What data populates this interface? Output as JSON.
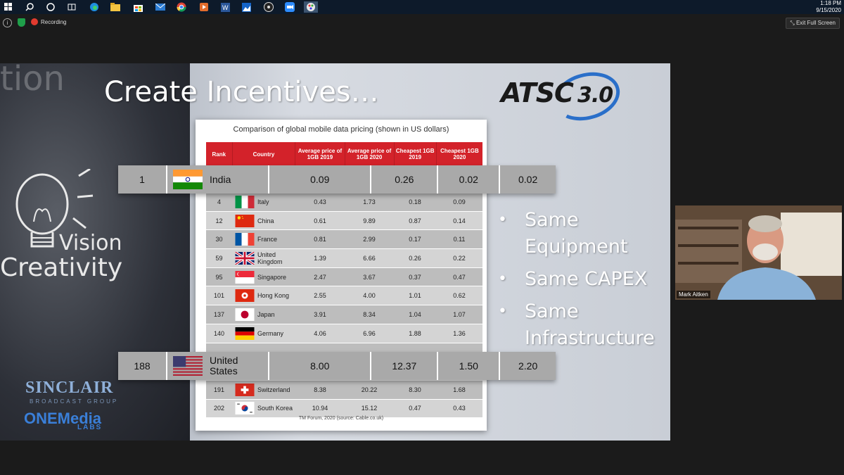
{
  "taskbar": {
    "icons": [
      "windows-icon",
      "search-icon",
      "task-view-icon",
      "widgets-icon",
      "edge-icon",
      "explorer-icon",
      "store-icon",
      "mail-icon",
      "chrome-icon",
      "media-icon",
      "word-icon",
      "photos-icon",
      "obs-icon",
      "zoom-icon",
      "paint-icon"
    ],
    "time": "1:18 PM",
    "date": "9/15/2020"
  },
  "zoom": {
    "recording_label": "Recording",
    "exit_label": "Exit Full Screen",
    "participant_name": "Mark Aitken"
  },
  "slide": {
    "title": "Create Incentives…",
    "logo_text": "ATSC",
    "logo_version": "3.0",
    "watermark_text": "tion",
    "vision": "Vision",
    "creativity": "Creativity",
    "sinclair": "SINCLAIR",
    "broadcast_group": "BROADCAST GROUP",
    "onemedia": "ONEMedia",
    "labs": "LABS",
    "bullets": [
      "Same Equipment",
      "Same CAPEX",
      "Same Infrastructure"
    ]
  },
  "table": {
    "title": "Comparison of global mobile data pricing (shown in US dollars)",
    "headers": [
      "Rank",
      "Country",
      "Average price of 1GB 2019",
      "Average price of 1GB 2020",
      "Cheapest 1GB 2019",
      "Cheapest 1GB 2020"
    ],
    "rows": [
      {
        "rank": "4",
        "country": "Italy",
        "flag": "italy",
        "a": "0.43",
        "b": "1.73",
        "c": "0.18",
        "d": "0.09"
      },
      {
        "rank": "12",
        "country": "China",
        "flag": "china",
        "a": "0.61",
        "b": "9.89",
        "c": "0.87",
        "d": "0.14"
      },
      {
        "rank": "30",
        "country": "France",
        "flag": "france",
        "a": "0.81",
        "b": "2.99",
        "c": "0.17",
        "d": "0.11"
      },
      {
        "rank": "59",
        "country": "United Kingdom",
        "flag": "uk",
        "a": "1.39",
        "b": "6.66",
        "c": "0.26",
        "d": "0.22"
      },
      {
        "rank": "95",
        "country": "Singapore",
        "flag": "singapore",
        "a": "2.47",
        "b": "3.67",
        "c": "0.37",
        "d": "0.47"
      },
      {
        "rank": "101",
        "country": "Hong Kong",
        "flag": "hongkong",
        "a": "2.55",
        "b": "4.00",
        "c": "1.01",
        "d": "0.62"
      },
      {
        "rank": "137",
        "country": "Japan",
        "flag": "japan",
        "a": "3.91",
        "b": "8.34",
        "c": "1.04",
        "d": "1.07"
      },
      {
        "rank": "140",
        "country": "Germany",
        "flag": "germany",
        "a": "4.06",
        "b": "6.96",
        "c": "1.88",
        "d": "1.36"
      },
      {
        "rank": "",
        "country": "",
        "flag": "",
        "a": "",
        "b": "",
        "c": "",
        "d": ""
      },
      {
        "rank": "",
        "country": "",
        "flag": "",
        "a": "",
        "b": "",
        "c": "",
        "d": ""
      },
      {
        "rank": "191",
        "country": "Switzerland",
        "flag": "switzerland",
        "a": "8.38",
        "b": "20.22",
        "c": "8.30",
        "d": "1.68"
      },
      {
        "rank": "202",
        "country": "South Korea",
        "flag": "southkorea",
        "a": "10.94",
        "b": "15.12",
        "c": "0.47",
        "d": "0.43"
      }
    ],
    "source": "TM Forum, 2020 (source: Cable.co.uk)"
  },
  "highlights": [
    {
      "rank": "1",
      "country": "India",
      "flag": "india",
      "a": "0.09",
      "b": "0.26",
      "c": "0.02",
      "d": "0.02"
    },
    {
      "rank": "188",
      "country": "United States",
      "flag": "usa",
      "a": "8.00",
      "b": "12.37",
      "c": "1.50",
      "d": "2.20"
    }
  ]
}
